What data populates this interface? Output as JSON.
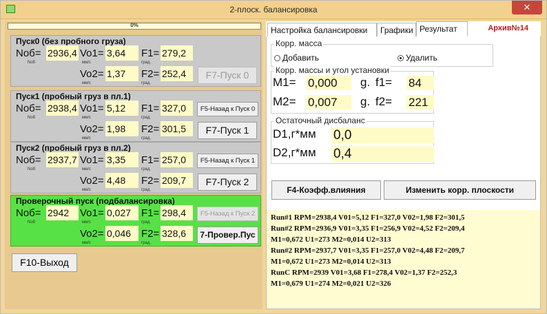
{
  "window": {
    "title": "2-плоск. балансировка",
    "close_label": "✕"
  },
  "progress": {
    "text": "0%",
    "value": 0
  },
  "runs": [
    {
      "title": "Пуск0 (без пробного груза)",
      "nob_label": "Nоб=",
      "nob_sub": "Nоб",
      "nob": "2936,4",
      "vo1_label": "Vo1=",
      "vo1_sub": "мм/с",
      "vo1": "3,64",
      "f1_label": "F1=",
      "f1_sub": "град.",
      "f1": "279,2",
      "vo2_label": "Vo2=",
      "vo2_sub": "мм/с",
      "vo2": "1,37",
      "f2_label": "F2=",
      "f2_sub": "град.",
      "f2": "252,4",
      "button": "F7-Пуск 0"
    },
    {
      "title": "Пуск1 (пробный груз в пл.1)",
      "nob_label": "Nоб=",
      "nob_sub": "Nоб",
      "nob": "2938,4",
      "vo1_label": "Vo1=",
      "vo1_sub": "мм/с",
      "vo1": "5,12",
      "f1_label": "F1=",
      "f1_sub": "град.",
      "f1": "327,0",
      "vo2_label": "Vo2=",
      "vo2_sub": "мм/с",
      "vo2": "1,98",
      "f2_label": "F2=",
      "f2_sub": "град.",
      "f2": "301,5",
      "back_button": "F5-Назад к Пуск 0",
      "button": "F7-Пуск 1"
    },
    {
      "title": "Пуск2 (пробный груз в пл.2)",
      "nob_label": "Nоб=",
      "nob_sub": "Nоб",
      "nob": "2937,7",
      "vo1_label": "Vo1=",
      "vo1_sub": "мм/с",
      "vo1": "3,35",
      "f1_label": "F1=",
      "f1_sub": "град.",
      "f1": "257,0",
      "vo2_label": "Vo2=",
      "vo2_sub": "мм/с",
      "vo2": "4,48",
      "f2_label": "F2=",
      "f2_sub": "град.",
      "f2": "209,7",
      "back_button": "F5-Назад к Пуск 1",
      "button": "F7-Пуск 2"
    },
    {
      "title": "Проверочный пуск (подбалансировка)",
      "nob_label": "Nоб=",
      "nob_sub": "Nоб",
      "nob": "2942",
      "vo1_label": "Vo1=",
      "vo1_sub": "мм/с",
      "vo1": "0,027",
      "f1_label": "F1=",
      "f1_sub": "град.",
      "f1": "298,4",
      "vo2_label": "Vo2=",
      "vo2_sub": "мм/с",
      "vo2": "0,046",
      "f2_label": "F2=",
      "f2_sub": "град.",
      "f2": "328,6",
      "back_button": "F5-Назад к Пуск 2",
      "button": "7-Провер.Пус"
    }
  ],
  "exit_button": "F10-Выход",
  "tabs": [
    {
      "label": "Настройка балансировки",
      "active": false
    },
    {
      "label": "Графики",
      "active": false
    },
    {
      "label": "Результат",
      "active": true
    }
  ],
  "archive": "Архив№14",
  "corr_mass": {
    "title": "Корр. масса",
    "options": [
      {
        "label": "Добавить",
        "selected": false
      },
      {
        "label": "Удалить",
        "selected": true
      }
    ]
  },
  "corr_angles": {
    "title": "Корр. массы и угол установки",
    "m1_label": "M1=",
    "m1": "0,000",
    "g1": "g.",
    "f1_label": "f1=",
    "f1": "84",
    "m2_label": "M2=",
    "m2": "0,007",
    "g2": "g.",
    "f2_label": "f2=",
    "f2": "221"
  },
  "residual": {
    "title": "Остаточный дисбаланс",
    "d1_label": "D1,г*мм",
    "d1": "0,0",
    "d2_label": "D2,г*мм",
    "d2": "0,4"
  },
  "buttons": {
    "influence": "F4-Коэфф.влияния",
    "change_planes": "Изменить корр. плоскости"
  },
  "log": [
    "Run#1 RPM=2938,4 V01=5,12 F1=327,0 V02=1,98 F2=301,5",
    "Run#2 RPM=2936,9 V01=3,35 F1=256,9 V02=4,52 F2=209,4",
    "M1=0,672 U1=273 M2=0,014 U2=313",
    "Run#2 RPM=2937,7 V01=3,35 F1=257,0 V02=4,48 F2=209,7",
    "M1=0,672 U1=273 M2=0,014 U2=313",
    "RunC  RPM=2939 V01=3,68 F1=278,4 V02=1,37 F2=252,3",
    "M1=0,679 U1=274 M2=0,021 U2=326"
  ],
  "colors": {
    "window_bg": "#f3d59a",
    "panel_gray": "#c9c9c9",
    "panel_green": "#58e146",
    "value_bg": "#fffbc7",
    "archive": "#c0171b"
  }
}
